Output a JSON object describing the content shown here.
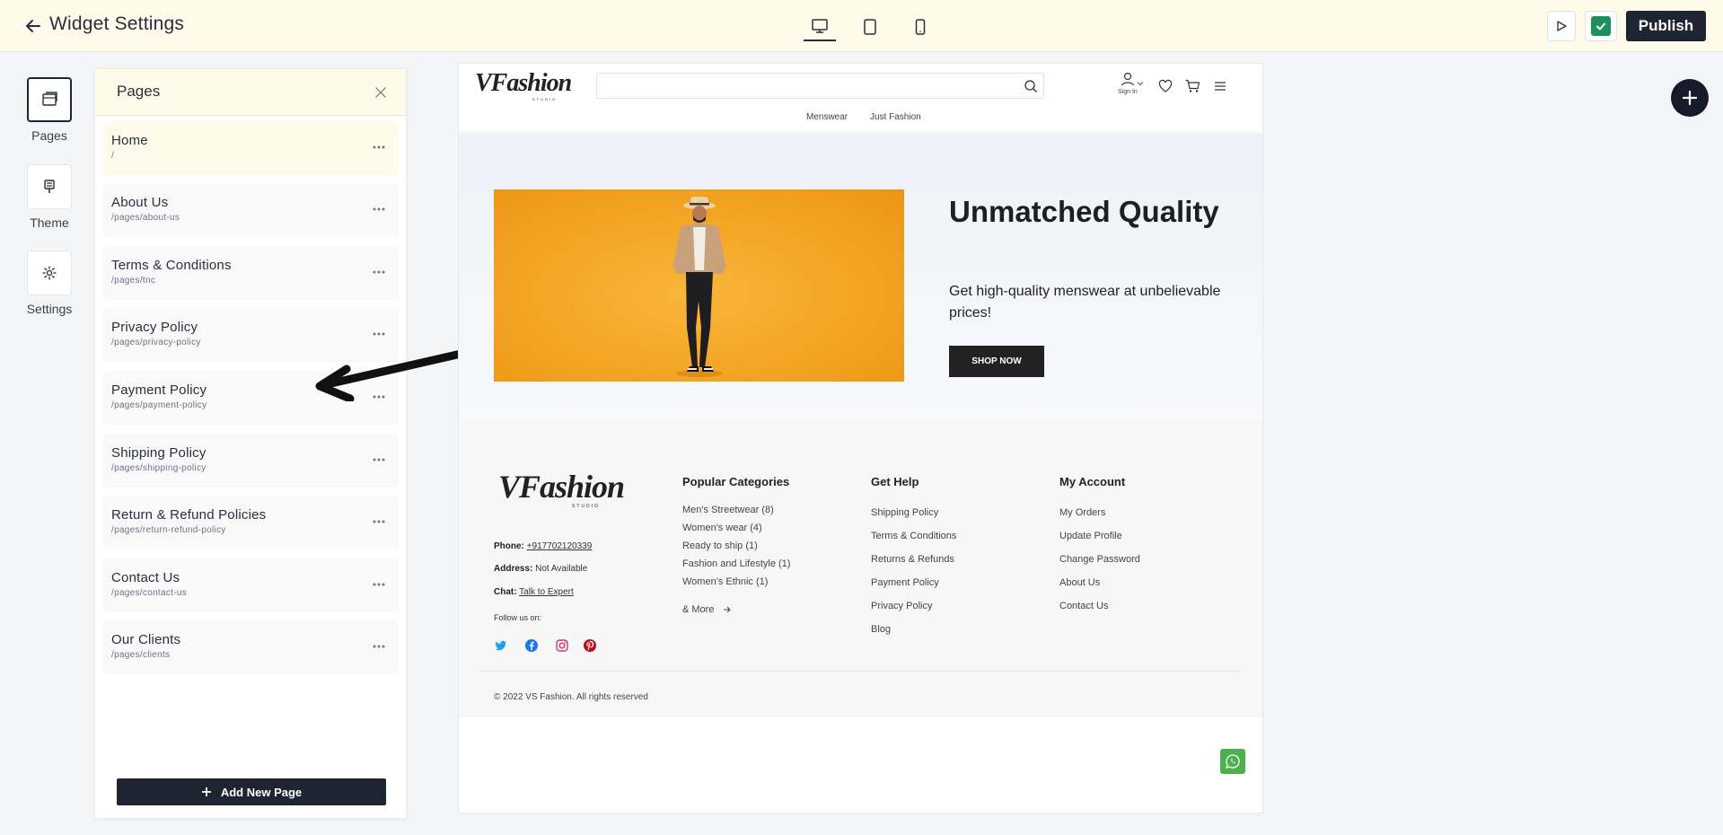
{
  "topbar": {
    "title": "Widget Settings",
    "devices": [
      "desktop-icon",
      "tablet-icon",
      "mobile-icon"
    ],
    "publish_label": "Publish"
  },
  "rail": {
    "items": [
      {
        "label": "Pages",
        "icon": "pages-icon"
      },
      {
        "label": "Theme",
        "icon": "theme-icon"
      },
      {
        "label": "Settings",
        "icon": "gear-icon"
      }
    ]
  },
  "panel": {
    "title": "Pages",
    "items": [
      {
        "name": "Home",
        "path": "/"
      },
      {
        "name": "About Us",
        "path": "/pages/about-us"
      },
      {
        "name": "Terms & Conditions",
        "path": "/pages/tnc"
      },
      {
        "name": "Privacy Policy",
        "path": "/pages/privacy-policy"
      },
      {
        "name": "Payment Policy",
        "path": "/pages/payment-policy"
      },
      {
        "name": "Shipping Policy",
        "path": "/pages/shipping-policy"
      },
      {
        "name": "Return & Refund Policies",
        "path": "/pages/return-refund-policy"
      },
      {
        "name": "Contact Us",
        "path": "/pages/contact-us"
      },
      {
        "name": "Our Clients",
        "path": "/pages/clients"
      }
    ],
    "add_label": "Add New Page"
  },
  "preview": {
    "logo": "VFashion",
    "logo_sub": "STUDIO",
    "nav": [
      "Menswear",
      "Just Fashion"
    ],
    "signin": "Sign In",
    "hero": {
      "title": "Unmatched Quality",
      "subtitle": "Get high-quality menswear at unbelievable prices!",
      "cta": "SHOP NOW"
    },
    "footer": {
      "phone_label": "Phone:",
      "phone": "+917702120339",
      "address_label": "Address:",
      "address": "Not Available",
      "chat_label": "Chat:",
      "chat": "Talk to Expert",
      "follow": "Follow us on:",
      "col1_title": "Popular Categories",
      "col1": [
        "Men's Streetwear (8)",
        "Women's wear (4)",
        "Ready to ship (1)",
        "Fashion and Lifestyle (1)",
        "Women's Ethnic (1)"
      ],
      "more": "& More",
      "col2_title": "Get Help",
      "col2": [
        "Shipping Policy",
        "Terms & Conditions",
        "Returns & Refunds",
        "Payment Policy",
        "Privacy Policy",
        "Blog"
      ],
      "col3_title": "My Account",
      "col3": [
        "My Orders",
        "Update Profile",
        "Change Password",
        "About Us",
        "Contact Us"
      ],
      "copyright": "© 2022 VS Fashion. All rights reserved"
    }
  },
  "colors": {
    "accent": "#1f2433",
    "banner": "#fffbeb",
    "check": "#1f8f5c",
    "whatsapp": "#4caf50"
  }
}
